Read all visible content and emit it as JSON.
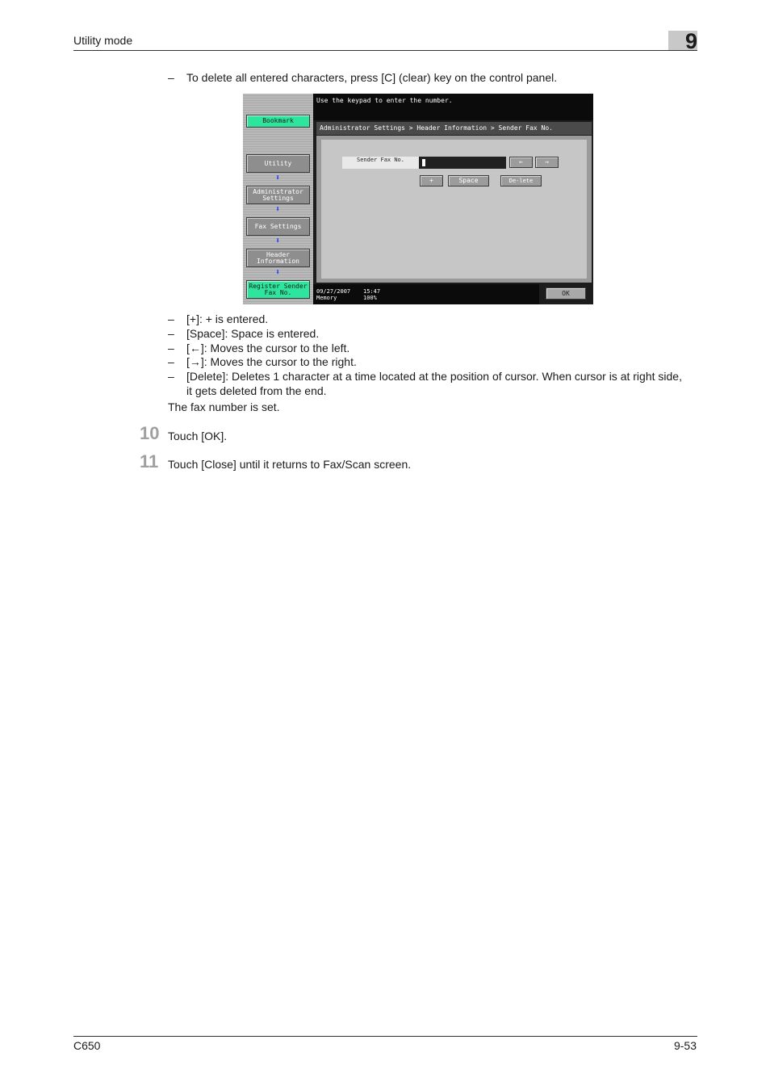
{
  "header": {
    "title": "Utility mode",
    "chapter": "9"
  },
  "intro_bullet": "To delete all entered characters, press [C] (clear) key on the control panel.",
  "screen": {
    "message": "Use the keypad to enter the number.",
    "breadcrumb": "Administrator Settings > Header Information > Sender Fax No.",
    "left_nav": {
      "bookmark": "Bookmark",
      "utility": "Utility",
      "admin_settings": "Administrator Settings",
      "fax_settings": "Fax Settings",
      "header_info": "Header Information",
      "register_sender": "Register Sender Fax No."
    },
    "field_label": "Sender Fax No.",
    "field_value": "",
    "buttons": {
      "left": "←",
      "right": "→",
      "plus": "+",
      "space": "Space",
      "delete": "De-lete",
      "ok": "OK"
    },
    "status": {
      "date": "09/27/2007",
      "time": "15:47",
      "memory_label": "Memory",
      "memory_value": "100%"
    }
  },
  "bullets": [
    "[+]: + is entered.",
    "[Space]: Space is entered.",
    "[←]: Moves the cursor to the left.",
    "[→]: Moves the cursor to the right.",
    "[Delete]: Deletes 1 character at a time located at the position of cursor. When cursor is at right side,",
    "it gets deleted from the end."
  ],
  "result_text": "The fax number is set.",
  "steps": [
    {
      "num": "10",
      "text": "Touch [OK]."
    },
    {
      "num": "11",
      "text": "Touch [Close] until it returns to Fax/Scan screen."
    }
  ],
  "footer": {
    "model": "C650",
    "page": "9-53"
  }
}
